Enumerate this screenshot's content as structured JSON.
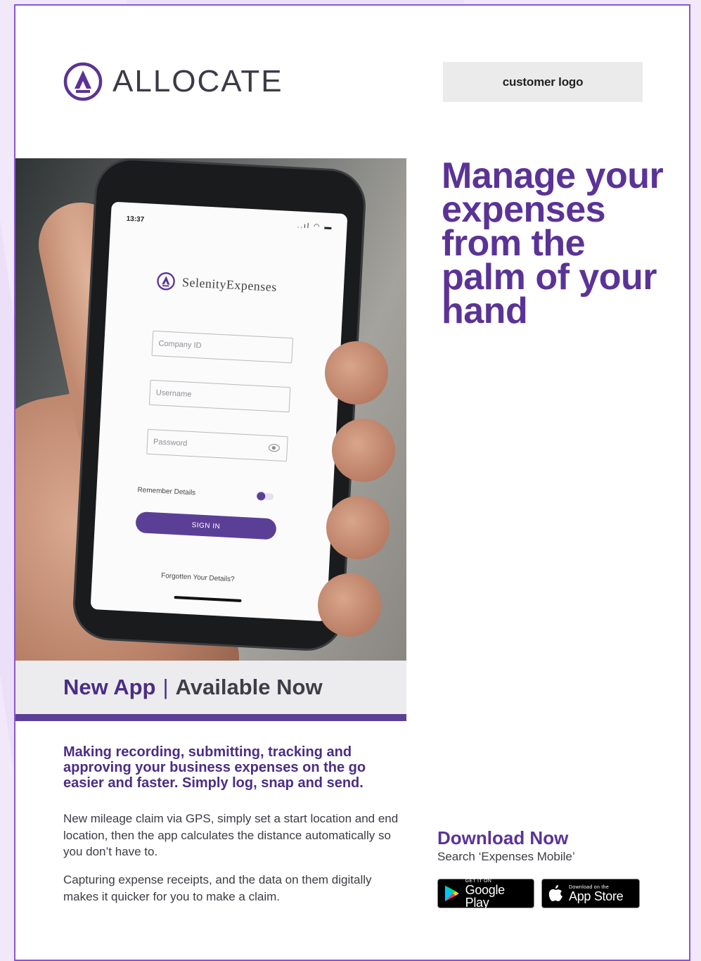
{
  "brand": {
    "name": "ALLOCATE",
    "accent": "#5b3396"
  },
  "customer_logo": {
    "label": "customer logo"
  },
  "headline": {
    "text": "Manage your expenses from the palm of your hand"
  },
  "phone_screen": {
    "time": "13:37",
    "status_icons": "..ıl ◠ ▬",
    "app_name": "SelenityExpenses",
    "company_id_placeholder": "Company ID",
    "username_placeholder": "Username",
    "password_placeholder": "Password",
    "remember_label": "Remember Details",
    "remember_on": true,
    "sign_in_label": "SIGN IN",
    "forgot_label": "Forgotten Your Details?"
  },
  "banner": {
    "part1": "New App",
    "separator": "|",
    "part2": "Available Now"
  },
  "lead": "Making recording, submitting, tracking and approving your business expenses on the go easier and faster. Simply log, snap and send.",
  "paragraphs": [
    "New mileage claim via GPS, simply set a start location and end location, then the app calculates the distance automatically so you don’t have to.",
    "Capturing expense receipts, and the data on them digitally makes it quicker for you to make a claim."
  ],
  "download": {
    "title": "Download Now",
    "subtitle": "Search ‘Expenses Mobile’",
    "google_small": "GET IT ON",
    "google_big": "Google Play",
    "apple_small": "Download on the",
    "apple_big": "App Store"
  }
}
